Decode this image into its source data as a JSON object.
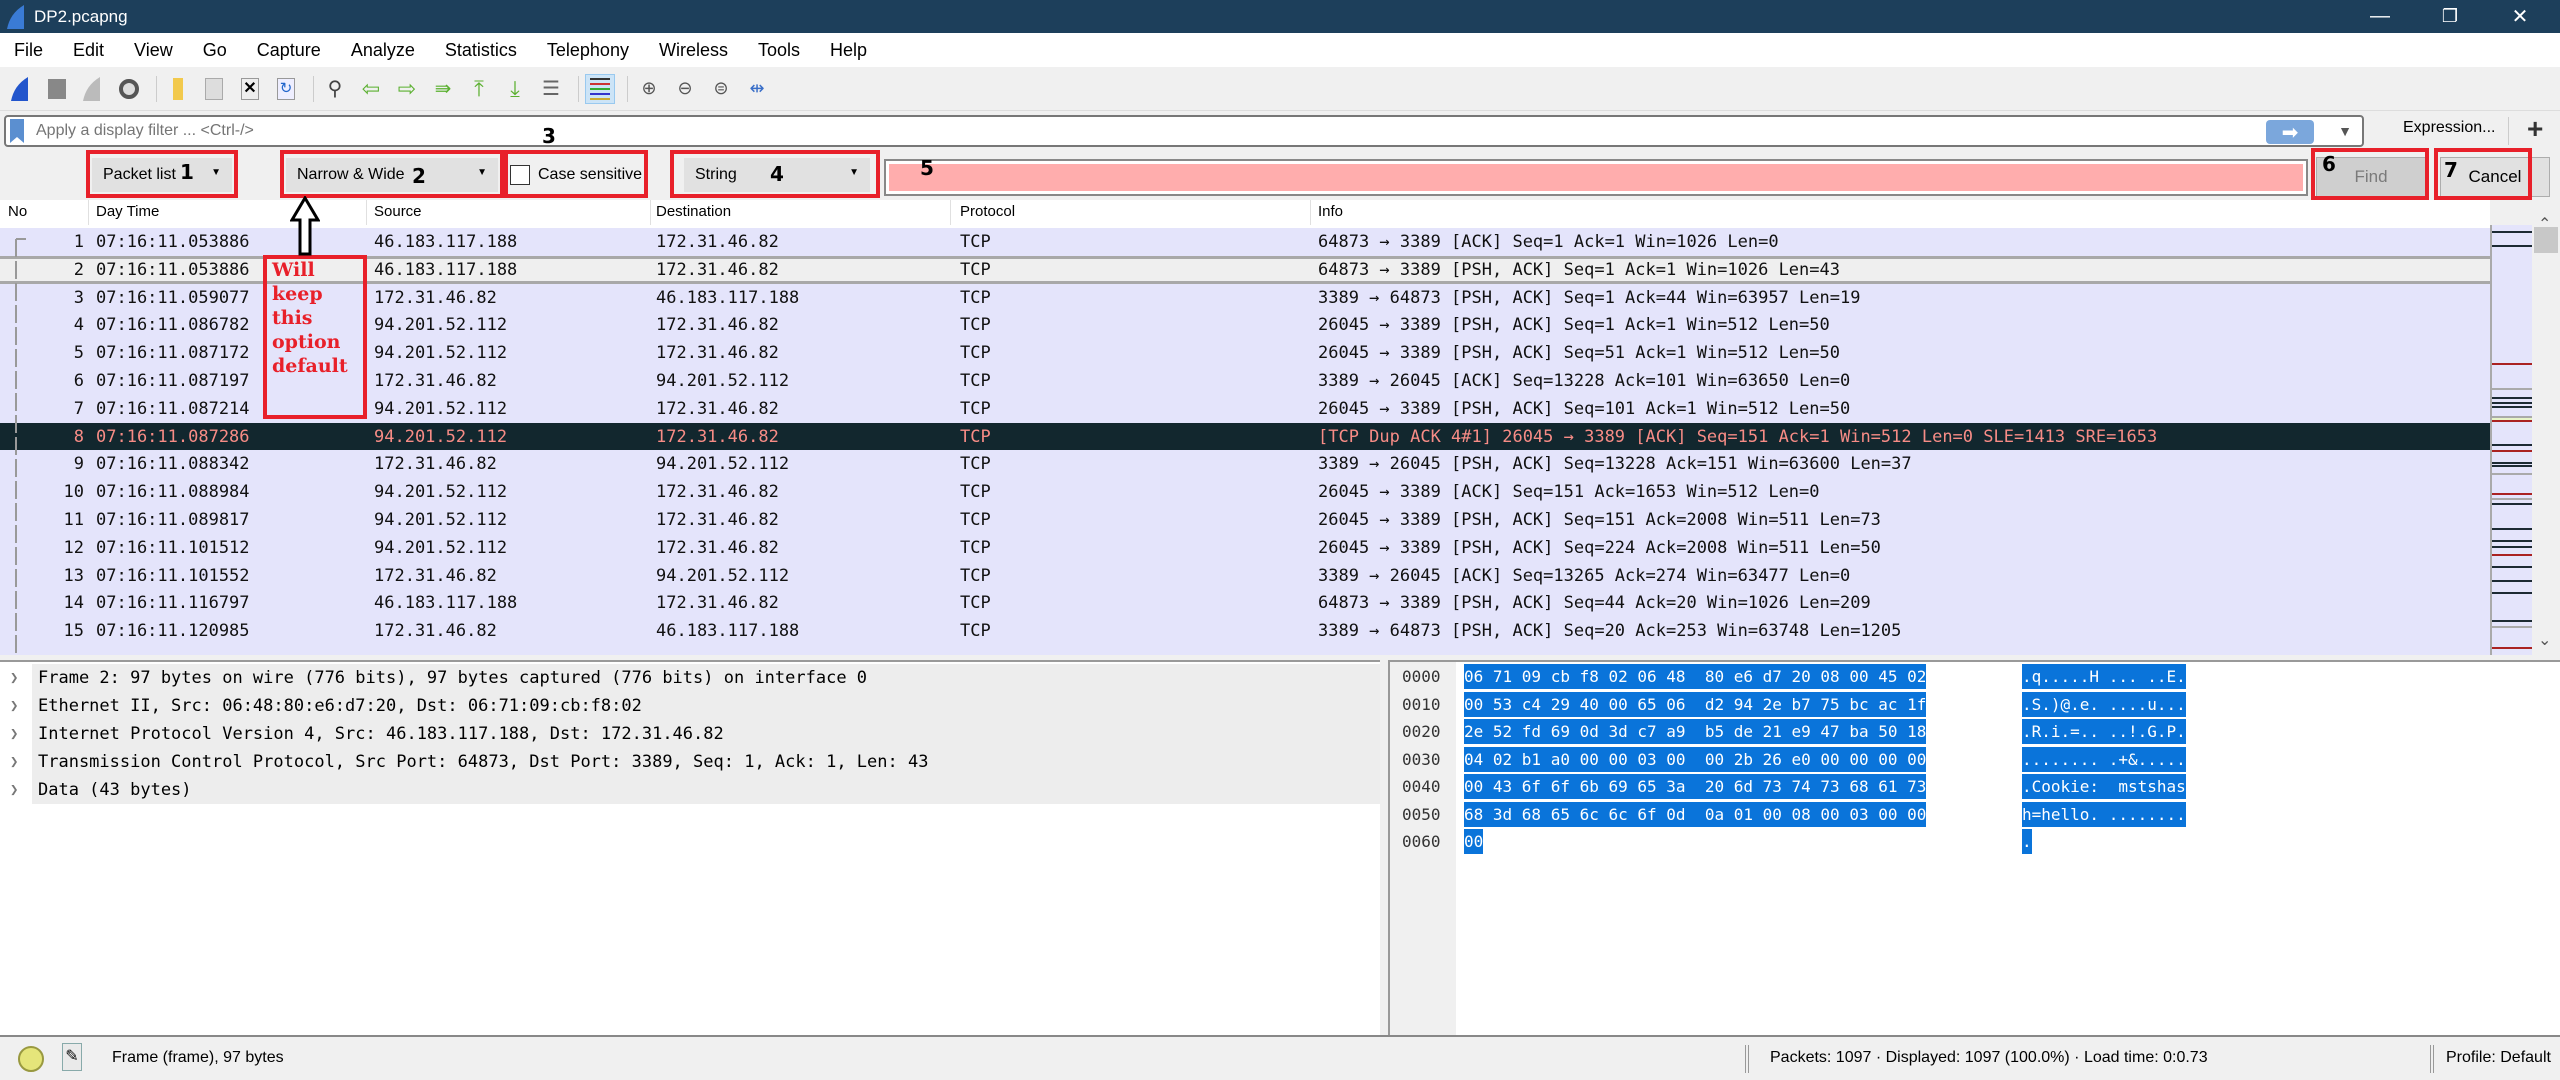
{
  "window": {
    "title": "DP2.pcapng"
  },
  "menu": [
    "File",
    "Edit",
    "View",
    "Go",
    "Capture",
    "Analyze",
    "Statistics",
    "Telephony",
    "Wireless",
    "Tools",
    "Help"
  ],
  "toolbar_icons": [
    "start-capture-icon",
    "stop-capture-icon",
    "restart-capture-icon",
    "capture-options-icon",
    "open-file-icon",
    "save-file-icon",
    "close-file-icon",
    "reload-file-icon",
    "find-packet-icon",
    "go-back-icon",
    "go-forward-icon",
    "go-to-packet-icon",
    "first-packet-icon",
    "last-packet-icon",
    "auto-scroll-icon",
    "colorize-icon",
    "zoom-in-icon",
    "zoom-out-icon",
    "normal-size-icon",
    "resize-columns-icon"
  ],
  "filter": {
    "placeholder": "Apply a display filter ... <Ctrl-/>",
    "value": "",
    "expression_label": "Expression...",
    "add_label": "+"
  },
  "find": {
    "search_in": "Packet list",
    "char_width": "Narrow & Wide",
    "case_sensitive_label": "Case sensitive",
    "case_sensitive": false,
    "search_type": "String",
    "search_value": "",
    "find_label": "Find",
    "cancel_label": "Cancel"
  },
  "annotations": {
    "n1": "1",
    "n2": "2",
    "n3": "3",
    "n4": "4",
    "n5": "5",
    "n6": "6",
    "n7": "7",
    "note": [
      "Will",
      "keep",
      "this",
      "option",
      "default"
    ]
  },
  "columns": [
    "No",
    "Day Time",
    "Source",
    "Destination",
    "Protocol",
    "Info"
  ],
  "packets": [
    {
      "no": "1",
      "time": "07:16:11.053886",
      "src": "46.183.117.188",
      "dst": "172.31.46.82",
      "proto": "TCP",
      "info": "64873 → 3389 [ACK] Seq=1 Ack=1 Win=1026 Len=0"
    },
    {
      "no": "2",
      "time": "07:16:11.053886",
      "src": "46.183.117.188",
      "dst": "172.31.46.82",
      "proto": "TCP",
      "info": "64873 → 3389 [PSH, ACK] Seq=1 Ack=1 Win=1026 Len=43"
    },
    {
      "no": "3",
      "time": "07:16:11.059077",
      "src": "172.31.46.82",
      "dst": "46.183.117.188",
      "proto": "TCP",
      "info": "3389 → 64873 [PSH, ACK] Seq=1 Ack=44 Win=63957 Len=19"
    },
    {
      "no": "4",
      "time": "07:16:11.086782",
      "src": "94.201.52.112",
      "dst": "172.31.46.82",
      "proto": "TCP",
      "info": "26045 → 3389 [PSH, ACK] Seq=1 Ack=1 Win=512 Len=50"
    },
    {
      "no": "5",
      "time": "07:16:11.087172",
      "src": "94.201.52.112",
      "dst": "172.31.46.82",
      "proto": "TCP",
      "info": "26045 → 3389 [PSH, ACK] Seq=51 Ack=1 Win=512 Len=50"
    },
    {
      "no": "6",
      "time": "07:16:11.087197",
      "src": "172.31.46.82",
      "dst": "94.201.52.112",
      "proto": "TCP",
      "info": "3389 → 26045 [ACK] Seq=13228 Ack=101 Win=63650 Len=0"
    },
    {
      "no": "7",
      "time": "07:16:11.087214",
      "src": "94.201.52.112",
      "dst": "172.31.46.82",
      "proto": "TCP",
      "info": "26045 → 3389 [PSH, ACK] Seq=101 Ack=1 Win=512 Len=50"
    },
    {
      "no": "8",
      "time": "07:16:11.087286",
      "src": "94.201.52.112",
      "dst": "172.31.46.82",
      "proto": "TCP",
      "info": "[TCP Dup ACK 4#1] 26045 → 3389 [ACK] Seq=151 Ack=1 Win=512 Len=0 SLE=1413 SRE=1653"
    },
    {
      "no": "9",
      "time": "07:16:11.088342",
      "src": "172.31.46.82",
      "dst": "94.201.52.112",
      "proto": "TCP",
      "info": "3389 → 26045 [PSH, ACK] Seq=13228 Ack=151 Win=63600 Len=37"
    },
    {
      "no": "10",
      "time": "07:16:11.088984",
      "src": "94.201.52.112",
      "dst": "172.31.46.82",
      "proto": "TCP",
      "info": "26045 → 3389 [ACK] Seq=151 Ack=1653 Win=512 Len=0"
    },
    {
      "no": "11",
      "time": "07:16:11.089817",
      "src": "94.201.52.112",
      "dst": "172.31.46.82",
      "proto": "TCP",
      "info": "26045 → 3389 [PSH, ACK] Seq=151 Ack=2008 Win=511 Len=73"
    },
    {
      "no": "12",
      "time": "07:16:11.101512",
      "src": "94.201.52.112",
      "dst": "172.31.46.82",
      "proto": "TCP",
      "info": "26045 → 3389 [PSH, ACK] Seq=224 Ack=2008 Win=511 Len=50"
    },
    {
      "no": "13",
      "time": "07:16:11.101552",
      "src": "172.31.46.82",
      "dst": "94.201.52.112",
      "proto": "TCP",
      "info": "3389 → 26045 [ACK] Seq=13265 Ack=274 Win=63477 Len=0"
    },
    {
      "no": "14",
      "time": "07:16:11.116797",
      "src": "46.183.117.188",
      "dst": "172.31.46.82",
      "proto": "TCP",
      "info": "64873 → 3389 [PSH, ACK] Seq=44 Ack=20 Win=1026 Len=209"
    },
    {
      "no": "15",
      "time": "07:16:11.120985",
      "src": "172.31.46.82",
      "dst": "46.183.117.188",
      "proto": "TCP",
      "info": "3389 → 64873 [PSH, ACK] Seq=20 Ack=253 Win=63748 Len=1205"
    }
  ],
  "selected_packet": "2",
  "details": [
    "Frame 2: 97 bytes on wire (776 bits), 97 bytes captured (776 bits) on interface 0",
    "Ethernet II, Src: 06:48:80:e6:d7:20, Dst: 06:71:09:cb:f8:02",
    "Internet Protocol Version 4, Src: 46.183.117.188, Dst: 172.31.46.82",
    "Transmission Control Protocol, Src Port: 64873, Dst Port: 3389, Seq: 1, Ack: 1, Len: 43",
    "Data (43 bytes)"
  ],
  "hex": [
    {
      "off": "0000",
      "hex": "06 71 09 cb f8 02 06 48  80 e6 d7 20 08 00 45 02",
      "ascii": ".q.....H ... ..E."
    },
    {
      "off": "0010",
      "hex": "00 53 c4 29 40 00 65 06  d2 94 2e b7 75 bc ac 1f",
      "ascii": ".S.)@.e. ....u..."
    },
    {
      "off": "0020",
      "hex": "2e 52 fd 69 0d 3d c7 a9  b5 de 21 e9 47 ba 50 18",
      "ascii": ".R.i.=.. ..!.G.P."
    },
    {
      "off": "0030",
      "hex": "04 02 b1 a0 00 00 03 00  00 2b 26 e0 00 00 00 00",
      "ascii": "........ .+&....."
    },
    {
      "off": "0040",
      "hex": "00 43 6f 6f 6b 69 65 3a  20 6d 73 74 73 68 61 73",
      "ascii": ".Cookie:  mstshas"
    },
    {
      "off": "0050",
      "hex": "68 3d 68 65 6c 6c 6f 0d  0a 01 00 08 00 03 00 00",
      "ascii": "h=hello. ........"
    },
    {
      "off": "0060",
      "hex": "00",
      "ascii": "."
    }
  ],
  "status": {
    "frame_info": "Frame (frame), 97 bytes",
    "packets": "Packets: 1097 · Displayed: 1097 (100.0%) ·  Load time: 0:0.73",
    "profile": "Profile: Default"
  },
  "colors": {
    "title_bg": "#1d3f5b",
    "row_bg": "#e4e4fb",
    "dark_row_bg": "#12272e",
    "dark_row_fg": "#f78c86",
    "selection": "#0a74da",
    "search_invalid": "#ffadad",
    "annotation": "#e8202a"
  }
}
